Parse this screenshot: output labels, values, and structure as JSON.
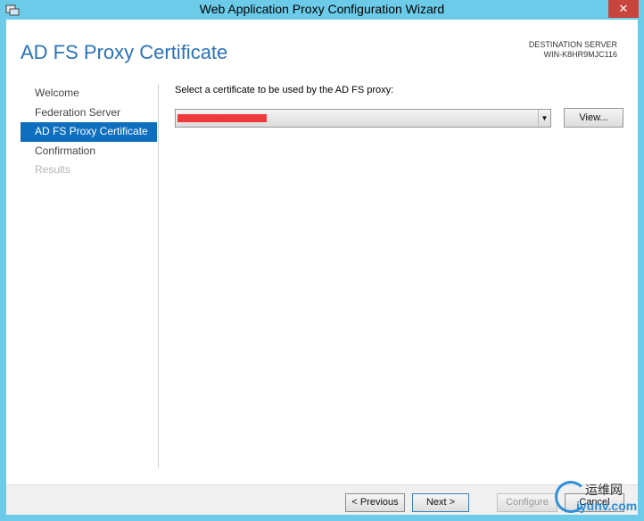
{
  "window": {
    "title": "Web Application Proxy Configuration Wizard",
    "close_glyph": "✕"
  },
  "header": {
    "page_title": "AD FS Proxy Certificate",
    "destination_label": "DESTINATION SERVER",
    "destination_server": "WIN-K8HR9MJC116"
  },
  "nav": {
    "items": [
      {
        "label": "Welcome",
        "state": "normal"
      },
      {
        "label": "Federation Server",
        "state": "normal"
      },
      {
        "label": "AD FS Proxy Certificate",
        "state": "active"
      },
      {
        "label": "Confirmation",
        "state": "normal"
      },
      {
        "label": "Results",
        "state": "disabled"
      }
    ]
  },
  "main": {
    "prompt": "Select a certificate to be used by the AD FS proxy:",
    "certificate_value": "",
    "dropdown_icon": "chevron-down-icon",
    "view_button": "View..."
  },
  "footer": {
    "previous": "< Previous",
    "next": "Next >",
    "configure": "Configure",
    "cancel": "Cancel"
  },
  "watermark": {
    "cn": "运维网",
    "en": "iyunv.com"
  },
  "colors": {
    "titlebar": "#6ccbe9",
    "accent": "#2c72b7",
    "nav_active": "#0f6fbf",
    "redaction": "#f0393d"
  }
}
